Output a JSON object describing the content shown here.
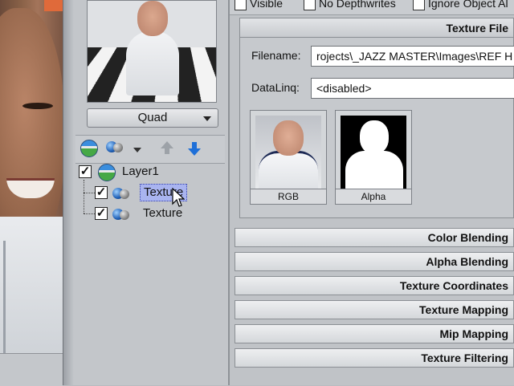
{
  "top_options": {
    "visible": "Visible",
    "no_depthwrites": "No Depthwrites",
    "ignore_object_alpha": "Ignore Object Al"
  },
  "preview": {
    "mode_dropdown": "Quad"
  },
  "layer_tree": {
    "layer": {
      "label": "Layer1",
      "checked": true
    },
    "textures": [
      {
        "label": "Texture",
        "checked": true,
        "selected": true
      },
      {
        "label": "Texture",
        "checked": true,
        "selected": false
      }
    ]
  },
  "texture_file": {
    "header": "Texture File",
    "filename_label": "Filename:",
    "filename_value": "rojects\\_JAZZ MASTER\\Images\\REF H",
    "dataling_label": "DataLinq:",
    "dataling_value": "<disabled>",
    "thumbnails": [
      {
        "caption": "RGB"
      },
      {
        "caption": "Alpha"
      }
    ]
  },
  "rollouts": [
    "Color Blending",
    "Alpha Blending",
    "Texture Coordinates",
    "Texture Mapping",
    "Mip Mapping",
    "Texture Filtering"
  ],
  "colors": {
    "selection": "#a9b4f0",
    "panel_bg": "#c0c3c7",
    "accent_blue": "#1e6fd8"
  }
}
